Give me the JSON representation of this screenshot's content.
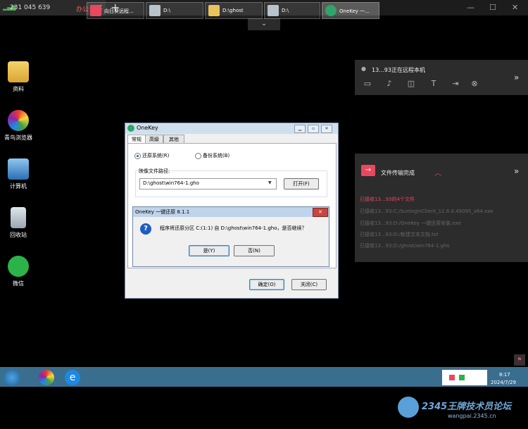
{
  "top_bar": {
    "signal_icon": "signal-bars-icon",
    "session_id": "231 045 639",
    "session_tag": "办公",
    "close_tab": "✕",
    "add_tab": "+",
    "minimize": "—",
    "restore": "☐",
    "close": "✕"
  },
  "collapse_toolbar": "⌄",
  "desktop_icons": [
    {
      "label": "资料",
      "icon": "folder-user-icon"
    },
    {
      "label": "青鸟浏览器",
      "icon": "browser-icon"
    },
    {
      "label": "计算机",
      "icon": "computer-icon"
    },
    {
      "label": "回收站",
      "icon": "recycle-bin-icon"
    },
    {
      "label": "微信",
      "icon": "wechat-icon"
    }
  ],
  "remote_panel": {
    "title": "13...93正在远程本机",
    "collapse": "»",
    "actions": [
      "chat-icon",
      "microphone-icon",
      "camera-icon",
      "text-icon",
      "transfer-icon",
      "stop-icon"
    ]
  },
  "transfer_panel": {
    "title": "文件传输完成",
    "collapse": "»",
    "summary": "已接收13...93的4个文件",
    "files": [
      "已接收13...93:C:/SunloginClient_12.6.0.49095_x64.exe",
      "已接收13...93:D:/OneKey 一键还原安装.exe",
      "已接收13...93:D:/新建文本文档.txt",
      "已接收13...93:D:/ghost/win764-1.gho"
    ]
  },
  "onekey_dialog": {
    "title": "OneKey",
    "tabs": [
      "常规",
      "高级",
      "其他"
    ],
    "radio_restore": "还原系统(R)",
    "radio_backup": "备份系统(B)",
    "image_path_label": "映像文件路径:",
    "image_path": "D:\\ghost\\win764-1.gho",
    "open_button": "打开(F)",
    "ok_button": "确定(O)",
    "close_button": "关闭(C)"
  },
  "confirm_dialog": {
    "title": "OneKey 一键还原 8.1.1",
    "message": "程序将还原分区 C:(1:1) 自 D:\\ghost\\win764-1.gho，是否继续？",
    "yes_button": "是(Y)",
    "no_button": "否(N)"
  },
  "taskbar": {
    "items": [
      {
        "label": "向日葵远程...",
        "icon": "sunlogin-icon"
      },
      {
        "label": "D:\\",
        "icon": "drive-icon"
      },
      {
        "label": "D:\\ghost",
        "icon": "folder-icon"
      },
      {
        "label": "D:\\",
        "icon": "drive-icon"
      },
      {
        "label": "OneKey 一...",
        "icon": "onekey-icon"
      }
    ],
    "time": "8:17",
    "date": "2024/7/29"
  },
  "watermark": {
    "text": "2345王牌技术员论坛",
    "url": "wangpai.2345.cn"
  },
  "colors": {
    "accent_red": "#e8485e",
    "taskbar": "#3a6e8f",
    "dialog_title": "#cfdfee"
  }
}
